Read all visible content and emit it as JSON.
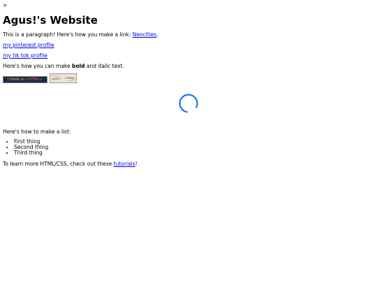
{
  "stray_text": ">",
  "page": {
    "title": "Agus!'s Website",
    "intro_text": "This is a paragraph! Here's how you make a link: ",
    "intro_link": "Neocities",
    "intro_end": ".",
    "links": [
      {
        "label": "my pinterest profile"
      },
      {
        "label": "my tik tok profile"
      }
    ],
    "format": {
      "prefix": "Here's how you can make ",
      "bold": "bold",
      "middle": " and ",
      "italic": "italic",
      "suffix": " text."
    },
    "badges": [
      {
        "text_a": "I think in ",
        "text_b": "<HTML>"
      }
    ],
    "list_intro": "Here's how to make a list:",
    "list_items": [
      "First thing",
      "Second thing",
      "Third thing"
    ],
    "outro": {
      "prefix": "To learn more HTML/CSS, check out these ",
      "link": "tutorials",
      "suffix": "!"
    }
  },
  "colors": {
    "link": "#0000ee",
    "spinner": "#1a73e8",
    "badge1_bg": "#1a2a4a"
  }
}
